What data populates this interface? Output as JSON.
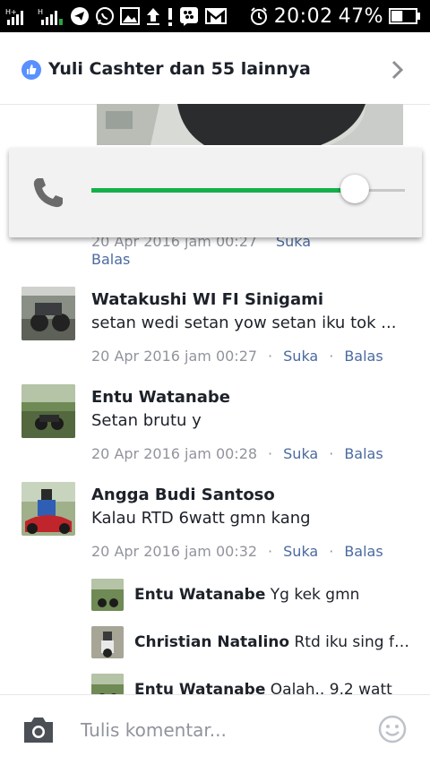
{
  "status_bar": {
    "clock": "20:02",
    "battery": "47%",
    "icons": [
      "signal-ht-icon",
      "signal-bars-icon",
      "telegram-icon",
      "whatsapp-icon",
      "image-icon",
      "upload-icon",
      "alert-icon",
      "bbm-icon",
      "gmail-icon",
      "alarm-icon",
      "battery-icon"
    ]
  },
  "header": {
    "likes_text": "Yuli Cashter dan 55 lainnya"
  },
  "top_partial": {
    "meta_date": "20 Apr 2016 jam 00:27",
    "meta_like": "Suka",
    "meta_reply": "Balas"
  },
  "volume": {
    "stream": "call",
    "level": 0.84
  },
  "comments": [
    {
      "name": "Watakushi WI FI Sinigami",
      "text": "setan wedi setan yow setan iku tok ...",
      "date": "20 Apr 2016 jam 00:27",
      "like": "Suka",
      "reply": "Balas"
    },
    {
      "name": "Entu Watanabe",
      "text": "Setan brutu y",
      "date": "20 Apr 2016 jam 00:28",
      "like": "Suka",
      "reply": "Balas"
    },
    {
      "name": "Angga Budi Santoso",
      "text": "Kalau RTD 6watt gmn kang",
      "date": "20 Apr 2016 jam 00:32",
      "like": "Suka",
      "reply": "Balas"
    }
  ],
  "replies": [
    {
      "name": "Entu Watanabe",
      "text": "Yg kek gmn"
    },
    {
      "name": "Christian Natalino",
      "text": "Rtd iku sing fog..."
    },
    {
      "name": "Entu Watanabe",
      "text": "Oalah.. 9,2 watt"
    }
  ],
  "composer": {
    "placeholder": "Tulis komentar..."
  },
  "colors": {
    "accent": "#14b14b",
    "link": "#4b6aa0",
    "like_badge": "#5890ff"
  }
}
